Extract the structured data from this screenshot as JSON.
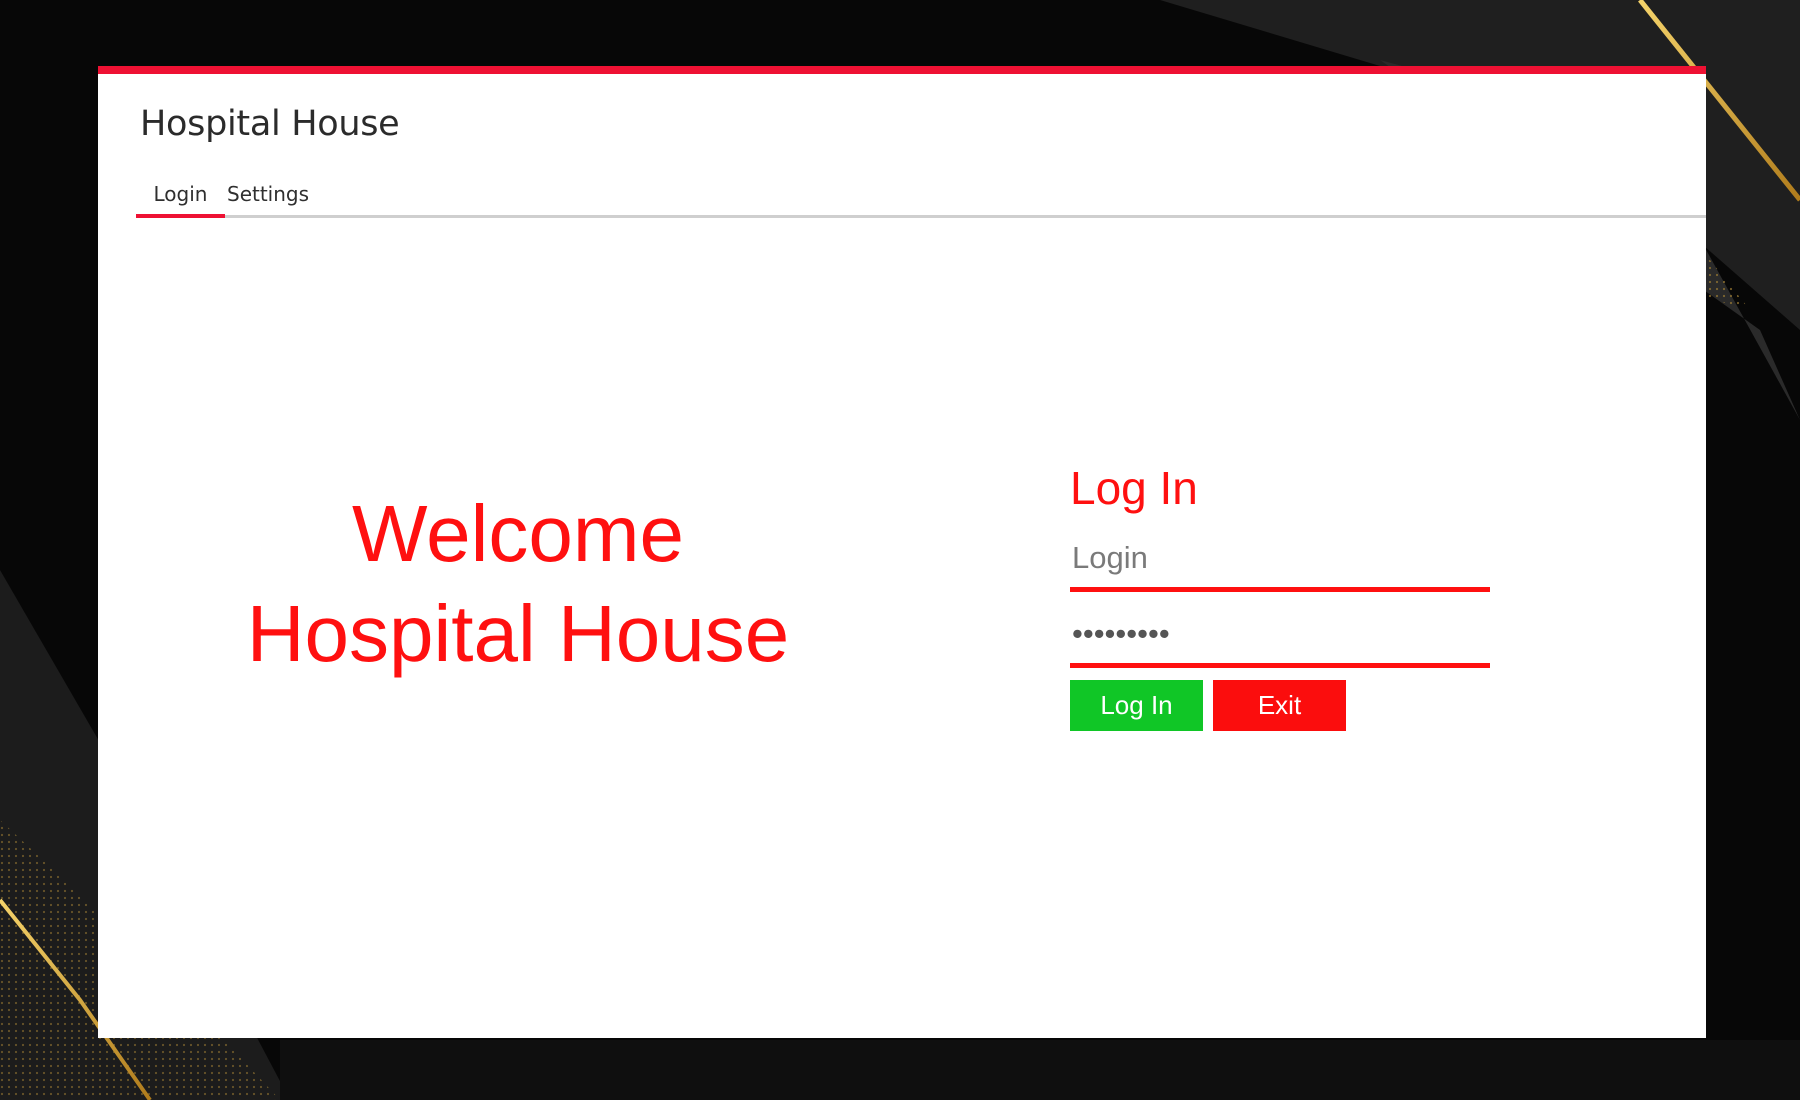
{
  "app": {
    "title": "Hospital House",
    "tabs": [
      {
        "label": "Login",
        "active": true
      },
      {
        "label": "Settings",
        "active": false
      }
    ]
  },
  "welcome": {
    "line1": "Welcome",
    "line2": "Hospital House"
  },
  "login_form": {
    "heading": "Log In",
    "login_field": {
      "value": "",
      "placeholder": "Login"
    },
    "password_field": {
      "value": "123456789",
      "masked": true
    },
    "login_button_label": "Log In",
    "exit_button_label": "Exit"
  },
  "colors": {
    "accent": "#ee1133",
    "text_red": "#ff1010",
    "login_button": "#10c626",
    "exit_button": "#fb0d0d",
    "background": "#070707",
    "gold": "#e0b030"
  }
}
